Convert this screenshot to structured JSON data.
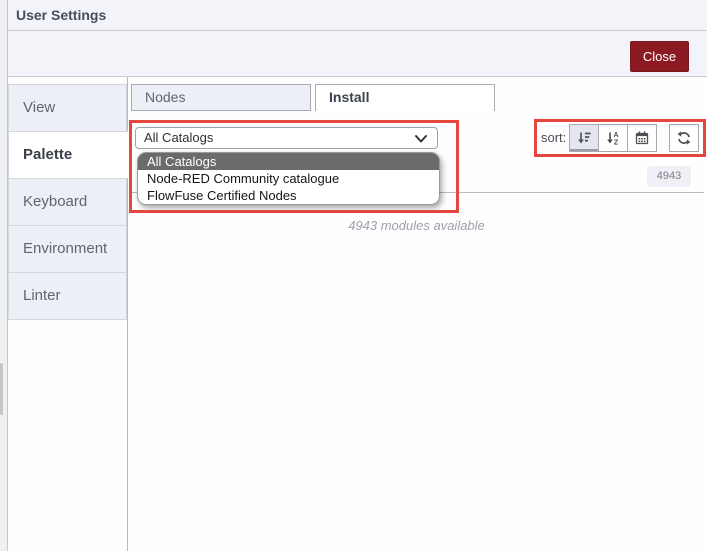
{
  "dialog": {
    "title": "User Settings",
    "close_label": "Close"
  },
  "sidebar": {
    "selected": "Palette",
    "items": [
      {
        "label": "View"
      },
      {
        "label": "Palette"
      },
      {
        "label": "Keyboard"
      },
      {
        "label": "Environment"
      },
      {
        "label": "Linter"
      }
    ]
  },
  "palette_tabs": {
    "nodes": "Nodes",
    "install": "Install",
    "selected": "Install"
  },
  "install": {
    "catalog_select": {
      "value": "All Catalogs",
      "selected_option": "All Catalogs",
      "options": [
        "All Catalogs",
        "Node-RED Community catalogue",
        "FlowFuse Certified Nodes"
      ]
    },
    "sort_label": "sort:",
    "count_badge": "4943",
    "modules_text": "4943 modules available"
  },
  "icons": {
    "select": "chevron-down-icon",
    "sort_buttons": [
      "sort-amount-icon",
      "sort-alpha-icon",
      "calendar-icon"
    ],
    "refresh": "refresh-icon"
  },
  "colors": {
    "close_button": "#8C1A23",
    "annotation_red": "#E5473F",
    "selected_option_bg": "#6B6B6B",
    "header_bg": "#f3f4f9",
    "tab_bg": "#edeff6"
  }
}
